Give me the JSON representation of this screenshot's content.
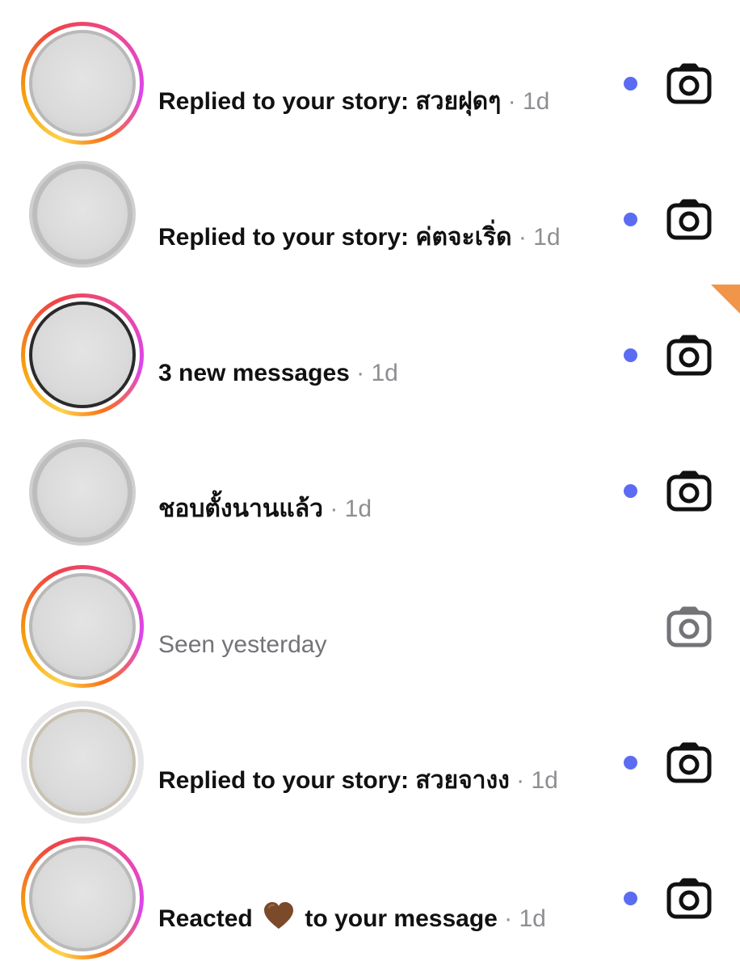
{
  "threads": [
    {
      "message": "Replied to your story: สวยฝุดๆ",
      "time": "· 1d",
      "unread": true,
      "story_ring": "gradient",
      "camera": "camera-icon"
    },
    {
      "message": "Replied to your story: ค่ตจะเริ่ด",
      "time": "· 1d",
      "unread": true,
      "story_ring": "none",
      "camera": "camera-icon"
    },
    {
      "message": "3 new messages",
      "time": "· 1d",
      "unread": true,
      "story_ring": "gradient",
      "camera": "camera-icon"
    },
    {
      "message": "ชอบตั้งนานแล้ว",
      "time": "· 1d",
      "unread": true,
      "story_ring": "none",
      "camera": "camera-icon"
    },
    {
      "message": "Seen yesterday",
      "time": "",
      "unread": false,
      "story_ring": "gradient",
      "camera": "camera-icon"
    },
    {
      "message": "Replied to your story: สวยจางง",
      "time": "· 1d",
      "unread": true,
      "story_ring": "seen",
      "camera": "camera-icon"
    },
    {
      "message_before": "Reacted",
      "reaction": "brown-heart-icon",
      "message_after": "to your message",
      "time": "· 1d",
      "unread": true,
      "story_ring": "gradient",
      "camera": "camera-icon"
    }
  ],
  "colors": {
    "unread_dot": "#5b6cf2",
    "camera_unread": "#111111",
    "camera_read": "#737378",
    "timestamp": "#8e8e93",
    "story_ring_gradient": [
      "#fcd34d",
      "#f59e0b",
      "#ef4444",
      "#ec4899",
      "#d946ef"
    ],
    "reaction_heart": "#7b4a2a"
  }
}
